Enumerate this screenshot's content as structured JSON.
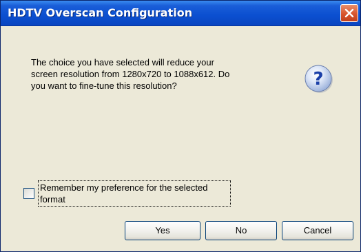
{
  "window": {
    "title": "HDTV Overscan Configuration",
    "close_icon": "close-icon",
    "title_color": "#0b4fd0",
    "background_color": "#ece9d8"
  },
  "dialog": {
    "message_lines": [
      "The choice you have selected will reduce your",
      "screen resolution from 1280x720 to 1088x612.  Do",
      "you want to fine-tune this resolution?"
    ],
    "icon": "question-icon"
  },
  "checkbox": {
    "label_lines": [
      "Remember my preference for the selected",
      "format"
    ],
    "checked": false
  },
  "buttons": {
    "yes": "Yes",
    "no": "No",
    "cancel": "Cancel"
  }
}
